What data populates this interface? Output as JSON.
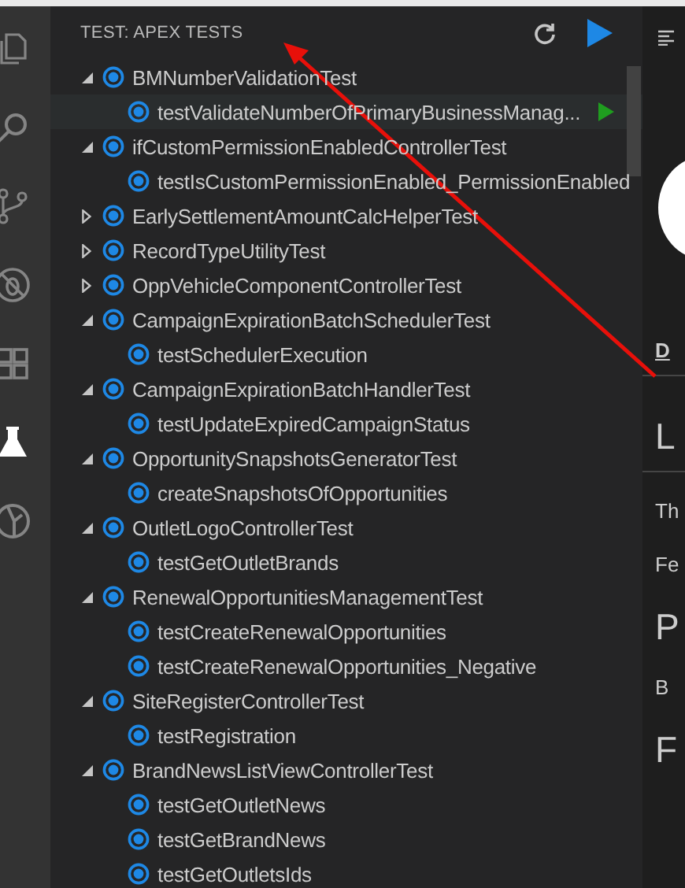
{
  "activity_bar": [
    {
      "kind": "files",
      "selected": false
    },
    {
      "kind": "search",
      "selected": false
    },
    {
      "kind": "source-control",
      "selected": false
    },
    {
      "kind": "debug",
      "selected": false
    },
    {
      "kind": "extensions",
      "selected": false
    },
    {
      "kind": "test",
      "selected": true
    },
    {
      "kind": "org",
      "selected": false
    }
  ],
  "panel": {
    "title": "TEST: APEX TESTS"
  },
  "classes": [
    {
      "name": "BMNumberValidationTest",
      "expanded": true,
      "tests": [
        {
          "name": "testValidateNumberOfPrimaryBusinessManag...",
          "selected": true
        }
      ]
    },
    {
      "name": "ifCustomPermissionEnabledControllerTest",
      "expanded": true,
      "tests": [
        {
          "name": "testIsCustomPermissionEnabled_PermissionEnabled",
          "selected": false
        }
      ]
    },
    {
      "name": "EarlySettlementAmountCalcHelperTest",
      "expanded": false
    },
    {
      "name": "RecordTypeUtilityTest",
      "expanded": false
    },
    {
      "name": "OppVehicleComponentControllerTest",
      "expanded": false
    },
    {
      "name": "CampaignExpirationBatchSchedulerTest",
      "expanded": true,
      "tests": [
        {
          "name": "testSchedulerExecution",
          "selected": false
        }
      ]
    },
    {
      "name": "CampaignExpirationBatchHandlerTest",
      "expanded": true,
      "tests": [
        {
          "name": "testUpdateExpiredCampaignStatus",
          "selected": false
        }
      ]
    },
    {
      "name": "OpportunitySnapshotsGeneratorTest",
      "expanded": true,
      "tests": [
        {
          "name": "createSnapshotsOfOpportunities",
          "selected": false
        }
      ]
    },
    {
      "name": "OutletLogoControllerTest",
      "expanded": true,
      "tests": [
        {
          "name": "testGetOutletBrands",
          "selected": false
        }
      ]
    },
    {
      "name": "RenewalOpportunitiesManagementTest",
      "expanded": true,
      "tests": [
        {
          "name": "testCreateRenewalOpportunities",
          "selected": false
        },
        {
          "name": "testCreateRenewalOpportunities_Negative",
          "selected": false
        }
      ]
    },
    {
      "name": "SiteRegisterControllerTest",
      "expanded": true,
      "tests": [
        {
          "name": "testRegistration",
          "selected": false
        }
      ]
    },
    {
      "name": "BrandNewsListViewControllerTest",
      "expanded": true,
      "tests": [
        {
          "name": "testGetOutletNews",
          "selected": false
        },
        {
          "name": "testGetBrandNews",
          "selected": false
        },
        {
          "name": "testGetOutletsIds",
          "selected": false
        }
      ]
    }
  ],
  "editor": {
    "fragments": [
      {
        "text": "D",
        "kind": "link",
        "ruled": true
      },
      {
        "text": "L",
        "kind": "heading",
        "ruled": true
      },
      {
        "text": "Th",
        "kind": "text",
        "ruled": false
      },
      {
        "text": "Fe",
        "kind": "text",
        "ruled": false
      },
      {
        "text": "P",
        "kind": "heading",
        "ruled": false
      },
      {
        "text": "B",
        "kind": "text",
        "ruled": false
      },
      {
        "text": "F",
        "kind": "heading",
        "ruled": false
      }
    ]
  }
}
